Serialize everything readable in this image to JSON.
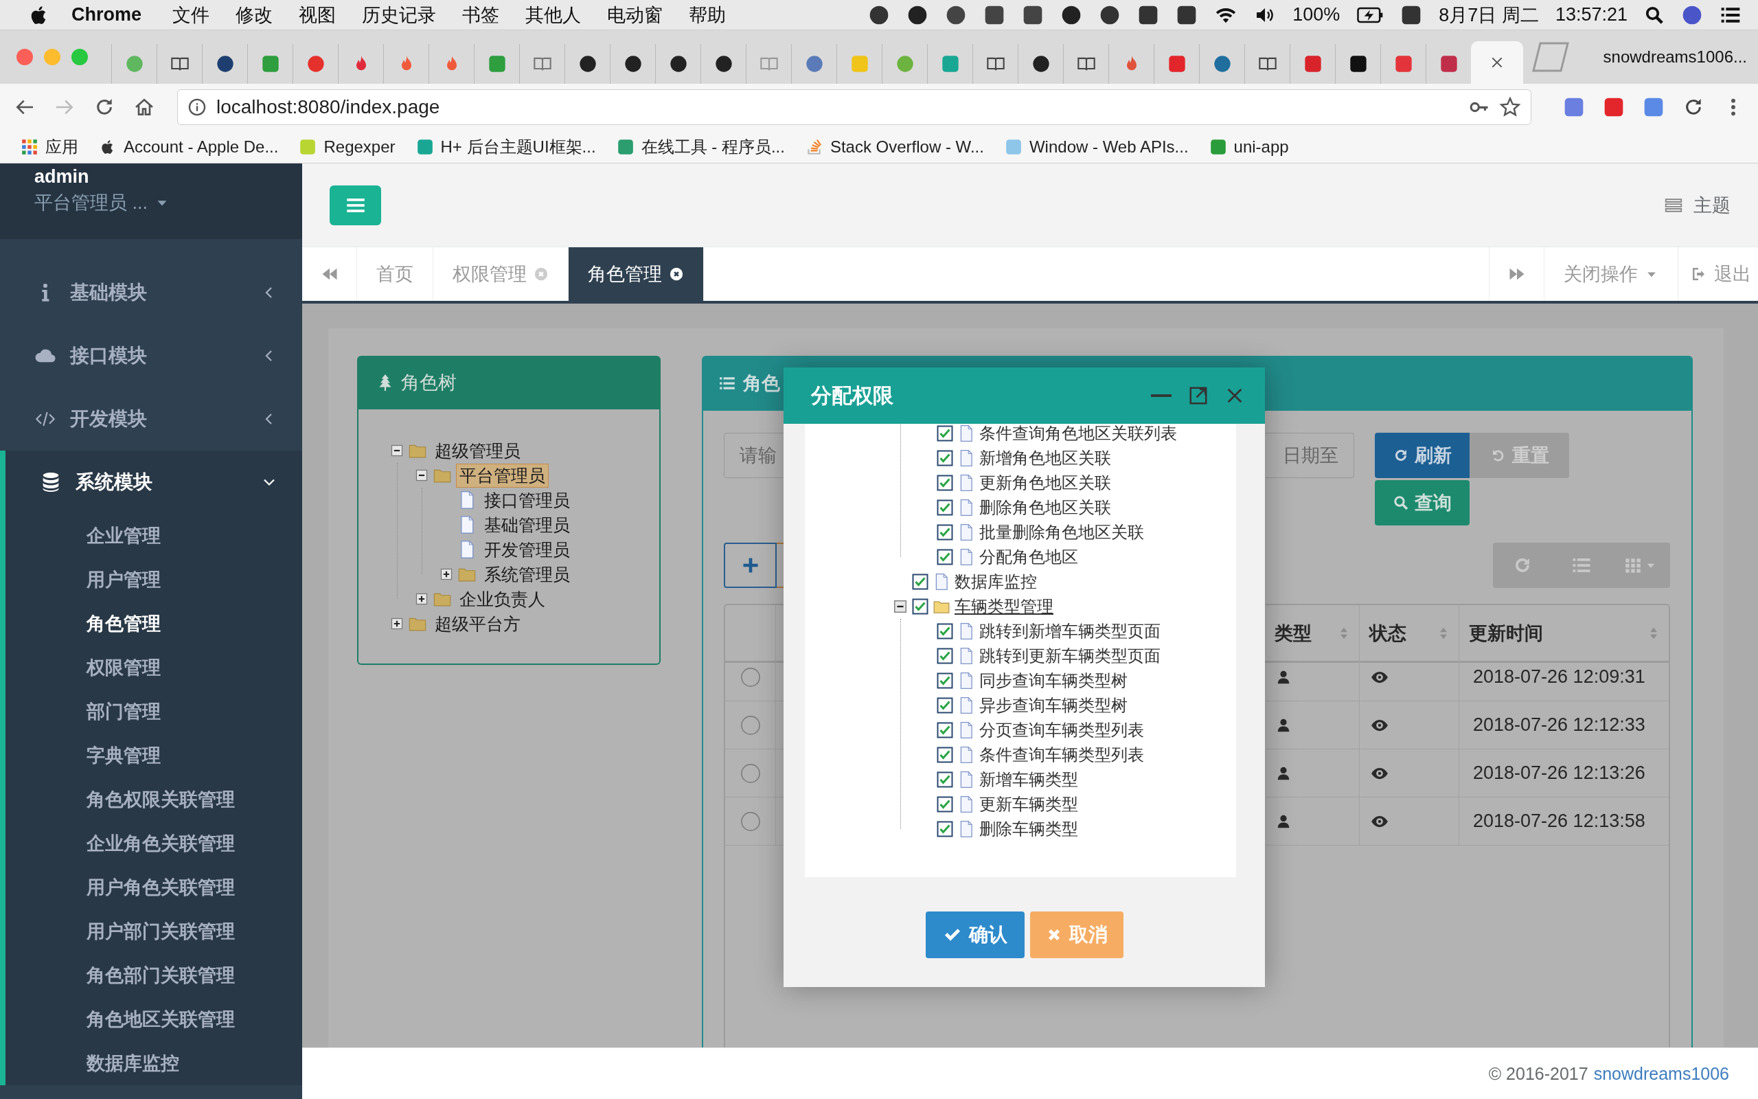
{
  "menubar": {
    "app": "Chrome",
    "menus": [
      "文件",
      "修改",
      "视图",
      "历史记录",
      "书签",
      "其他人",
      "电动窗",
      "帮助"
    ],
    "battery": "100%",
    "date": "8月7日 周二",
    "time": "13:57:21"
  },
  "browser": {
    "profile": "snowdreams1006...",
    "url": "localhost:8080/index.page",
    "bookmarks": [
      {
        "label": "应用",
        "kind": "grid"
      },
      {
        "label": "Account - Apple De...",
        "kind": "apple"
      },
      {
        "label": "Regexper",
        "kind": "square",
        "color": "#b9d532"
      },
      {
        "label": "H+ 后台主题UI框架...",
        "kind": "square",
        "color": "#19a794"
      },
      {
        "label": "在线工具 - 程序员...",
        "kind": "square",
        "color": "#2b9d6f"
      },
      {
        "label": "Stack Overflow - W...",
        "kind": "stack"
      },
      {
        "label": "Window - Web APIs...",
        "kind": "square",
        "color": "#8dc6e8"
      },
      {
        "label": "uni-app",
        "kind": "square",
        "color": "#2b9c3b"
      }
    ]
  },
  "sidebar": {
    "user": "admin",
    "role": "平台管理员 ...",
    "menu": [
      {
        "label": "基础模块",
        "kind": "info",
        "expanded": false
      },
      {
        "label": "接口模块",
        "kind": "cloud",
        "expanded": false
      },
      {
        "label": "开发模块",
        "kind": "code",
        "expanded": false
      },
      {
        "label": "系统模块",
        "kind": "database",
        "expanded": true,
        "children": [
          {
            "label": "企业管理",
            "selected": false
          },
          {
            "label": "用户管理",
            "selected": false
          },
          {
            "label": "角色管理",
            "selected": true
          },
          {
            "label": "权限管理",
            "selected": false
          },
          {
            "label": "部门管理",
            "selected": false
          },
          {
            "label": "字典管理",
            "selected": false
          },
          {
            "label": "角色权限关联管理",
            "selected": false
          },
          {
            "label": "企业角色关联管理",
            "selected": false
          },
          {
            "label": "用户角色关联管理",
            "selected": false
          },
          {
            "label": "用户部门关联管理",
            "selected": false
          },
          {
            "label": "角色部门关联管理",
            "selected": false
          },
          {
            "label": "角色地区关联管理",
            "selected": false
          },
          {
            "label": "数据库监控",
            "selected": false
          }
        ]
      }
    ]
  },
  "header": {
    "theme": "主题"
  },
  "page_tabs": [
    {
      "label": "首页",
      "closable": false,
      "selected": false
    },
    {
      "label": "权限管理",
      "closable": true,
      "selected": false
    },
    {
      "label": "角色管理",
      "closable": true,
      "selected": true
    }
  ],
  "tab_actions": {
    "close_menu": "关闭操作",
    "logout": "退出"
  },
  "role_tree": {
    "title": "角色树",
    "nodes": [
      {
        "label": "超级管理员",
        "kind": "folder",
        "expanded": true,
        "selected": false,
        "children": [
          {
            "label": "平台管理员",
            "kind": "folder",
            "expanded": true,
            "selected": true,
            "children": [
              {
                "label": "接口管理员",
                "kind": "file",
                "selected": false
              },
              {
                "label": "基础管理员",
                "kind": "file",
                "selected": false
              },
              {
                "label": "开发管理员",
                "kind": "file",
                "selected": false
              },
              {
                "label": "系统管理员",
                "kind": "folder",
                "expanded": false,
                "selected": false
              }
            ]
          },
          {
            "label": "企业负责人",
            "kind": "folder",
            "expanded": false,
            "selected": false
          }
        ]
      },
      {
        "label": "超级平台方",
        "kind": "folder",
        "expanded": false,
        "selected": false
      }
    ]
  },
  "role_list": {
    "title": "角色",
    "search_placeholder": "请输",
    "date_placeholder": "日期至",
    "buttons": {
      "refresh": "刷新",
      "reset": "重置",
      "query": "查询"
    },
    "columns": [
      {
        "label": "类型"
      },
      {
        "label": "状态"
      },
      {
        "label": "更新时间"
      }
    ],
    "rows": [
      {
        "selected": false,
        "updated": "2018-07-26 12:09:31"
      },
      {
        "selected": false,
        "updated": "2018-07-26 12:12:33"
      },
      {
        "selected": false,
        "updated": "2018-07-26 12:13:26"
      },
      {
        "selected": false,
        "updated": "2018-07-26 12:13:58"
      }
    ]
  },
  "dialog": {
    "title": "分配权限",
    "tree": {
      "scrolled_children": [
        {
          "label": "条件查询角色地区关联列表",
          "kind": "file",
          "checked": true,
          "selected": false
        },
        {
          "label": "新增角色地区关联",
          "kind": "file",
          "checked": true,
          "selected": false
        },
        {
          "label": "更新角色地区关联",
          "kind": "file",
          "checked": true,
          "selected": false
        },
        {
          "label": "删除角色地区关联",
          "kind": "file",
          "checked": true,
          "selected": false
        },
        {
          "label": "批量删除角色地区关联",
          "kind": "file",
          "checked": true,
          "selected": false
        },
        {
          "label": "分配角色地区",
          "kind": "file",
          "checked": true,
          "selected": false
        }
      ],
      "items": [
        {
          "label": "数据库监控",
          "kind": "file",
          "checked": true,
          "selected": false
        },
        {
          "label": "车辆类型管理",
          "kind": "folder",
          "expanded": true,
          "checked": true,
          "selected": true,
          "children": [
            {
              "label": "跳转到新增车辆类型页面",
              "kind": "file",
              "checked": true,
              "selected": false
            },
            {
              "label": "跳转到更新车辆类型页面",
              "kind": "file",
              "checked": true,
              "selected": false
            },
            {
              "label": "同步查询车辆类型树",
              "kind": "file",
              "checked": true,
              "selected": false
            },
            {
              "label": "异步查询车辆类型树",
              "kind": "file",
              "checked": true,
              "selected": false
            },
            {
              "label": "分页查询车辆类型列表",
              "kind": "file",
              "checked": true,
              "selected": false
            },
            {
              "label": "条件查询车辆类型列表",
              "kind": "file",
              "checked": true,
              "selected": false
            },
            {
              "label": "新增车辆类型",
              "kind": "file",
              "checked": true,
              "selected": false
            },
            {
              "label": "更新车辆类型",
              "kind": "file",
              "checked": true,
              "selected": false
            },
            {
              "label": "删除车辆类型",
              "kind": "file",
              "checked": true,
              "selected": false
            }
          ]
        }
      ]
    },
    "confirm": "确认",
    "cancel": "取消"
  },
  "footer": {
    "copyright": "© 2016-2017",
    "author": "snowdreams1006"
  }
}
